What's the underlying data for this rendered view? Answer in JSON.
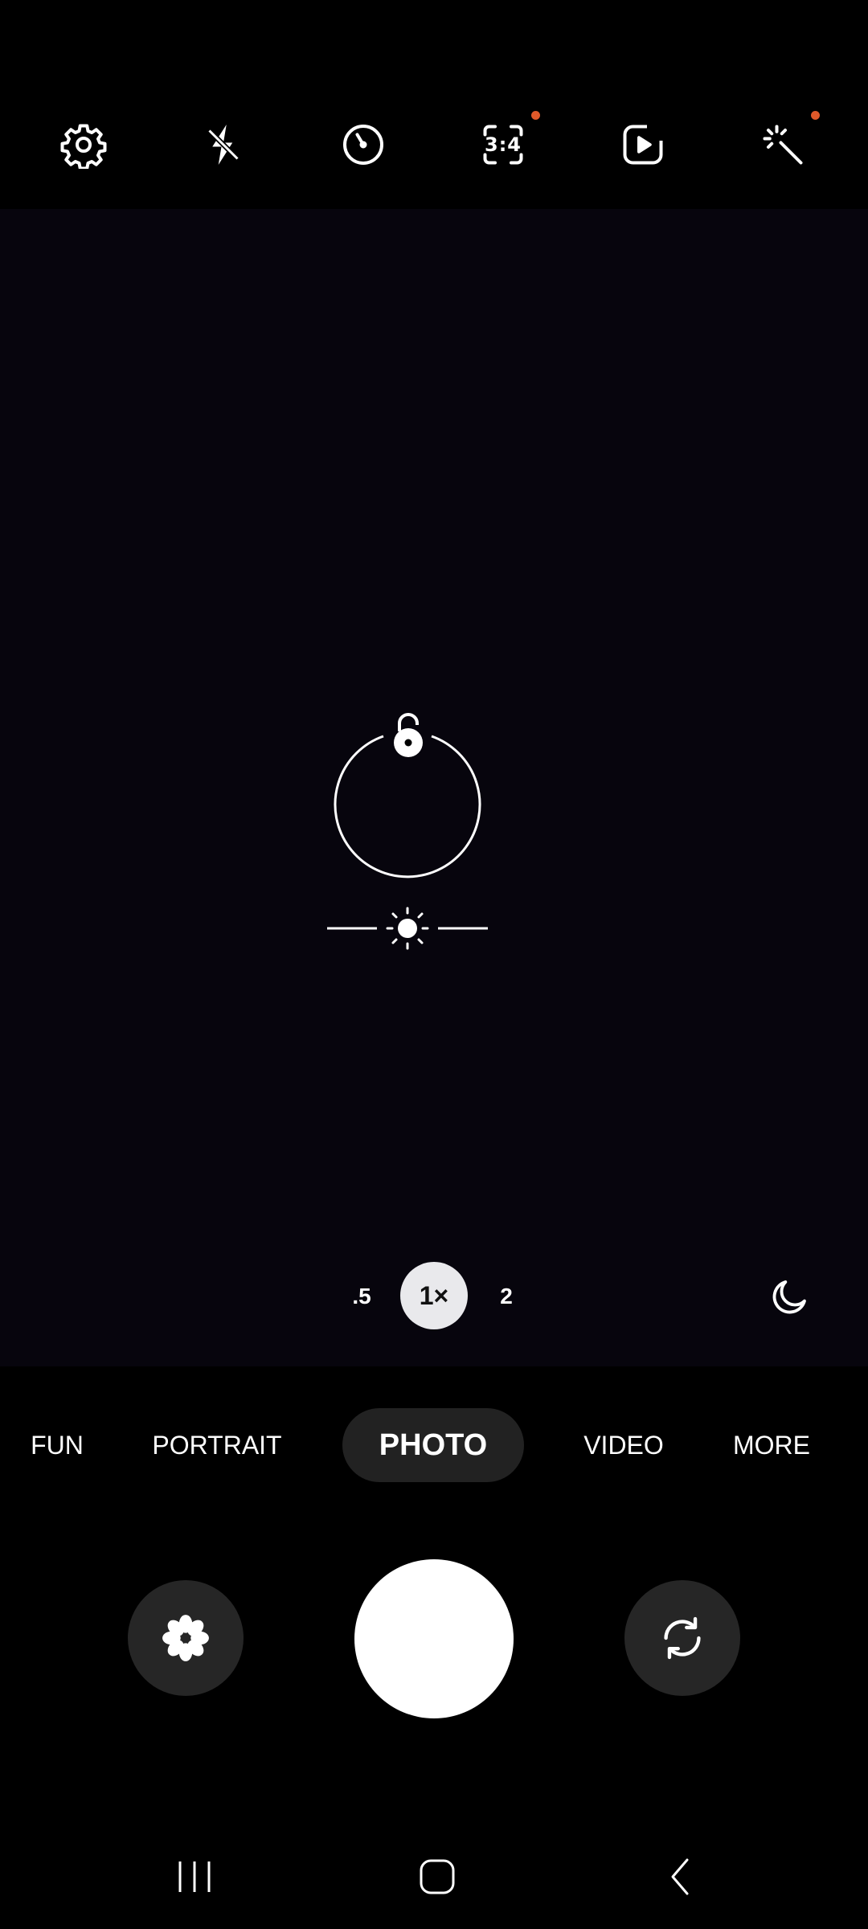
{
  "top_bar": {
    "settings_icon": "gear-icon",
    "flash_icon": "flash-off-icon",
    "timer_icon": "timer-icon",
    "ratio": {
      "label": "3:4",
      "has_badge": true
    },
    "motion_icon": "motion-photo-icon",
    "effects_icon": "magic-wand-icon",
    "effects_has_badge": true,
    "badge_color": "#e0592a"
  },
  "viewfinder": {
    "focus_icon": "unlock-icon",
    "exposure_icon": "sun-icon"
  },
  "zoom": {
    "options": [
      {
        "label": ".5"
      },
      {
        "label": "1×"
      },
      {
        "label": "2"
      }
    ],
    "active_index": 1,
    "night_icon": "moon-icon"
  },
  "modes": {
    "items": [
      "FUN",
      "PORTRAIT",
      "PHOTO",
      "VIDEO",
      "MORE"
    ],
    "active": "PHOTO"
  },
  "controls": {
    "left_icon": "flower-icon",
    "right_icon": "switch-camera-icon"
  },
  "navigation": {
    "recents_icon": "recents-icon",
    "home_icon": "home-icon",
    "back_icon": "back-icon"
  },
  "colors": {
    "background": "#000000",
    "viewfinder": "#07050d",
    "active_zoom_bg": "#e9e9ec",
    "active_mode_bg": "#222222",
    "side_button_bg": "#262626"
  }
}
